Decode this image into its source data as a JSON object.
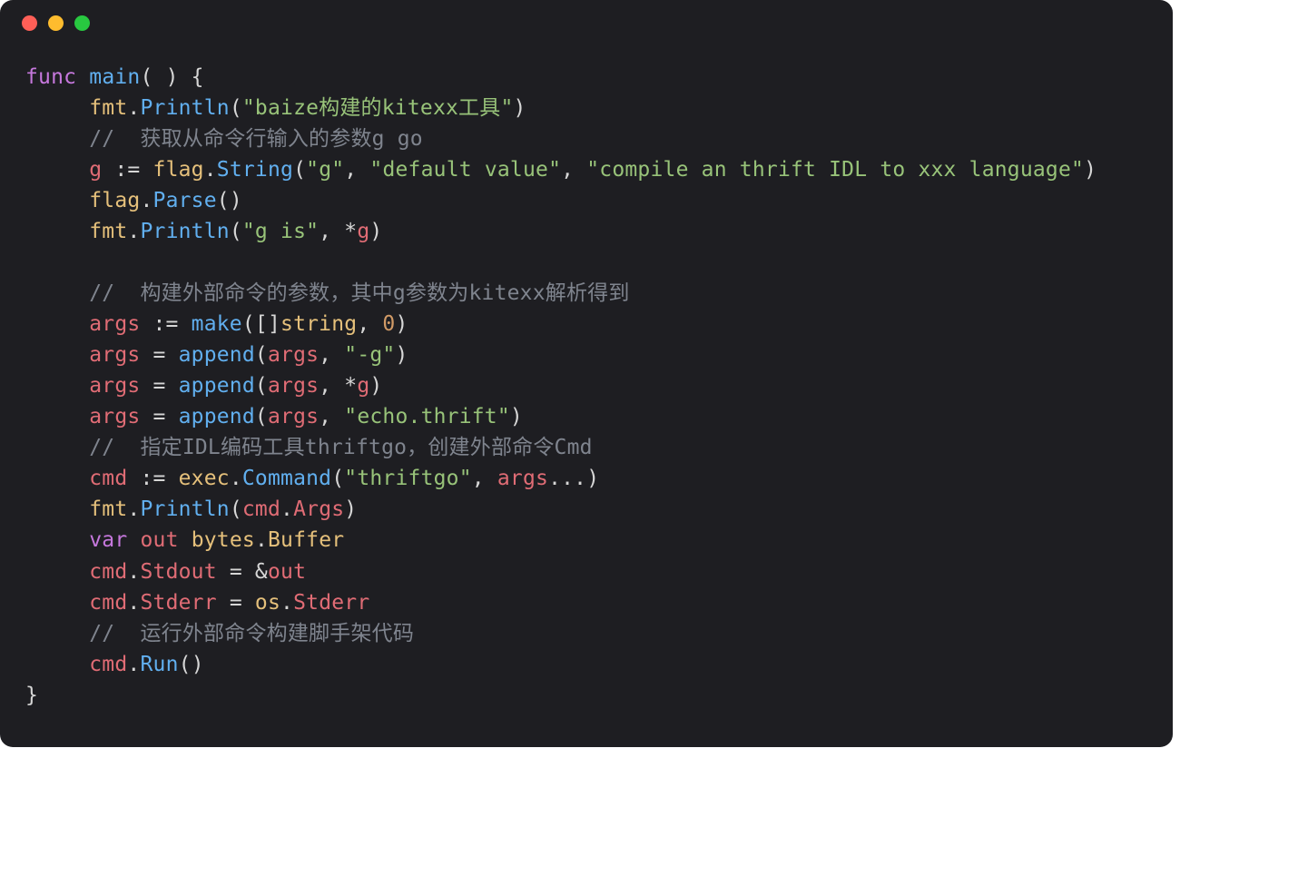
{
  "traffic": {
    "close": "close",
    "min": "minimize",
    "max": "maximize"
  },
  "code": {
    "l1": {
      "kw": "func",
      "fn": "main",
      "paren": "( )",
      "brace": " {"
    },
    "l2": {
      "id": "fmt",
      "dot": ".",
      "call": "Println",
      "open": "(",
      "str": "\"baize构建的kitexx工具\"",
      "close": ")"
    },
    "l3": {
      "comm": "//  获取从命令行输入的参数g go"
    },
    "l4": {
      "var": "g",
      "asg": " := ",
      "id": "flag",
      "dot": ".",
      "call": "String",
      "open": "(",
      "s1": "\"g\"",
      "c1": ", ",
      "s2": "\"default value\"",
      "c2": ", ",
      "s3": "\"compile an thrift IDL to xxx language\"",
      "close": ")"
    },
    "l5": {
      "id": "flag",
      "dot": ".",
      "call": "Parse",
      "open": "(",
      "close": ")"
    },
    "l6": {
      "id": "fmt",
      "dot": ".",
      "call": "Println",
      "open": "(",
      "s1": "\"g is\"",
      "c1": ", *",
      "v": "g",
      "close": ")"
    },
    "l8": {
      "comm": "//  构建外部命令的参数，其中g参数为kitexx解析得到"
    },
    "l9": {
      "v": "args",
      "asg": " := ",
      "call": "make",
      "open": "([]",
      "type": "string",
      "c1": ", ",
      "num": "0",
      "close": ")"
    },
    "l10": {
      "v": "args",
      "eq": " = ",
      "call": "append",
      "open": "(",
      "a1": "args",
      "c1": ", ",
      "s1": "\"-g\"",
      "close": ")"
    },
    "l11": {
      "v": "args",
      "eq": " = ",
      "call": "append",
      "open": "(",
      "a1": "args",
      "c1": ", *",
      "g": "g",
      "close": ")"
    },
    "l12": {
      "v": "args",
      "eq": " = ",
      "call": "append",
      "open": "(",
      "a1": "args",
      "c1": ", ",
      "s1": "\"echo.thrift\"",
      "close": ")"
    },
    "l13": {
      "comm": "//  指定IDL编码工具thriftgo，创建外部命令Cmd"
    },
    "l14": {
      "v": "cmd",
      "asg": " := ",
      "id": "exec",
      "dot": ".",
      "call": "Command",
      "open": "(",
      "s1": "\"thriftgo\"",
      "c1": ", ",
      "a1": "args",
      "c2": "...",
      "close": ")"
    },
    "l15": {
      "id": "fmt",
      "dot": ".",
      "call": "Println",
      "open": "(",
      "v": "cmd",
      "d2": ".",
      "f": "Args",
      "close": ")"
    },
    "l16": {
      "kw": "var",
      "sp": " ",
      "v": "out",
      "sp2": " ",
      "id": "bytes",
      "dot": ".",
      "t": "Buffer"
    },
    "l17": {
      "v": "cmd",
      "dot": ".",
      "f": "Stdout",
      "eq": " = &",
      "o": "out"
    },
    "l18": {
      "v": "cmd",
      "dot": ".",
      "f": "Stderr",
      "eq": " = ",
      "id": "os",
      "d2": ".",
      "f2": "Stderr"
    },
    "l19": {
      "comm": "//  运行外部命令构建脚手架代码"
    },
    "l20": {
      "v": "cmd",
      "dot": ".",
      "call": "Run",
      "open": "(",
      "close": ")"
    },
    "l21": {
      "brace": "}"
    },
    "indent": "     "
  }
}
